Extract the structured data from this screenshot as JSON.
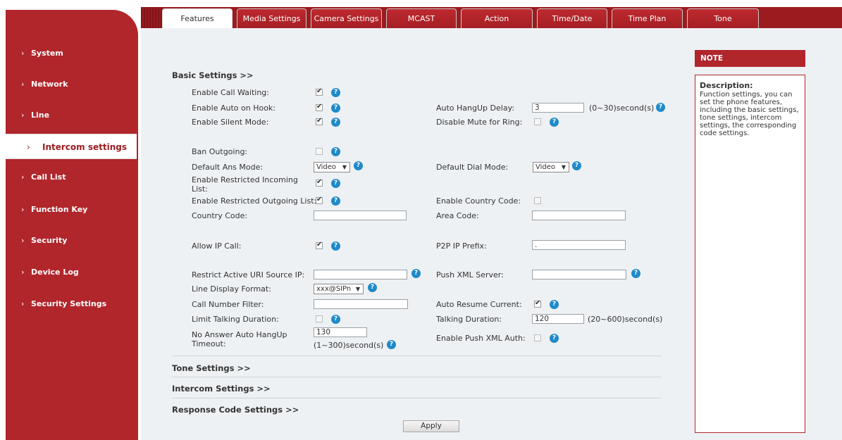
{
  "tabs": [
    {
      "label": "Features",
      "active": true
    },
    {
      "label": "Media Settings"
    },
    {
      "label": "Camera Settings"
    },
    {
      "label": "MCAST"
    },
    {
      "label": "Action"
    },
    {
      "label": "Time/Date"
    },
    {
      "label": "Time Plan"
    },
    {
      "label": "Tone"
    }
  ],
  "sidebar": {
    "items": [
      {
        "label": "System"
      },
      {
        "label": "Network"
      },
      {
        "label": "Line"
      },
      {
        "label": "Intercom settings",
        "active": true
      },
      {
        "label": "Call List"
      },
      {
        "label": "Function Key"
      },
      {
        "label": "Security"
      },
      {
        "label": "Device Log"
      },
      {
        "label": "Security Settings"
      }
    ],
    "arrow": "›"
  },
  "sections": {
    "basic": "Basic Settings >>",
    "tone": "Tone Settings >>",
    "intercom": "Intercom Settings >>",
    "response": "Response Code Settings >>"
  },
  "fields": {
    "call_waiting": {
      "label": "Enable Call Waiting:",
      "checked": true
    },
    "auto_on_hook": {
      "label": "Enable Auto on Hook:",
      "checked": true
    },
    "silent_mode": {
      "label": "Enable Silent Mode:",
      "checked": true
    },
    "auto_hangup_delay": {
      "label": "Auto HangUp Delay:",
      "value": "3",
      "unit": "(0~30)second(s)"
    },
    "disable_mute_ring": {
      "label": "Disable Mute for Ring:",
      "checked": false
    },
    "ban_outgoing": {
      "label": "Ban Outgoing:",
      "checked": false
    },
    "default_ans_mode": {
      "label": "Default Ans Mode:",
      "value": "Video"
    },
    "default_dial_mode": {
      "label": "Default Dial Mode:",
      "value": "Video"
    },
    "restricted_incoming": {
      "label": "Enable Restricted Incoming List:",
      "checked": true
    },
    "restricted_outgoing": {
      "label": "Enable Restricted Outgoing List:",
      "checked": true
    },
    "country_code_enable": {
      "label": "Enable Country Code:",
      "checked": false
    },
    "country_code": {
      "label": "Country Code:",
      "value": ""
    },
    "area_code": {
      "label": "Area Code:",
      "value": ""
    },
    "allow_ip_call": {
      "label": "Allow IP Call:",
      "checked": true
    },
    "p2p_ip_prefix": {
      "label": "P2P IP Prefix:",
      "value": "."
    },
    "restrict_uri": {
      "label": "Restrict Active URI Source IP:",
      "value": ""
    },
    "push_xml_server": {
      "label": "Push XML Server:",
      "value": ""
    },
    "line_display_format": {
      "label": "Line Display Format:",
      "value": "xxx@SIPn"
    },
    "call_number_filter": {
      "label": "Call Number Filter:",
      "value": ""
    },
    "auto_resume_current": {
      "label": "Auto Resume Current:",
      "checked": true
    },
    "limit_talking": {
      "label": "Limit Talking Duration:",
      "checked": false
    },
    "talking_duration": {
      "label": "Talking Duration:",
      "value": "120",
      "unit": "(20~600)second(s)"
    },
    "no_answer_timeout": {
      "label": "No Answer Auto HangUp Timeout:",
      "value": "130",
      "unit": "(1~300)second(s)"
    },
    "push_xml_auth": {
      "label": "Enable Push XML Auth:",
      "checked": false
    }
  },
  "apply_label": "Apply",
  "help_glyph": "?",
  "caret_glyph": "▼",
  "note": {
    "header": "NOTE",
    "title": "Description:",
    "text": "Function settings, you can set the phone features, including the basic settings, tone settings, intercom settings, the corresponding code settings."
  },
  "colors": {
    "brand_red": "#b0262b",
    "help_blue": "#1f8ac9"
  }
}
